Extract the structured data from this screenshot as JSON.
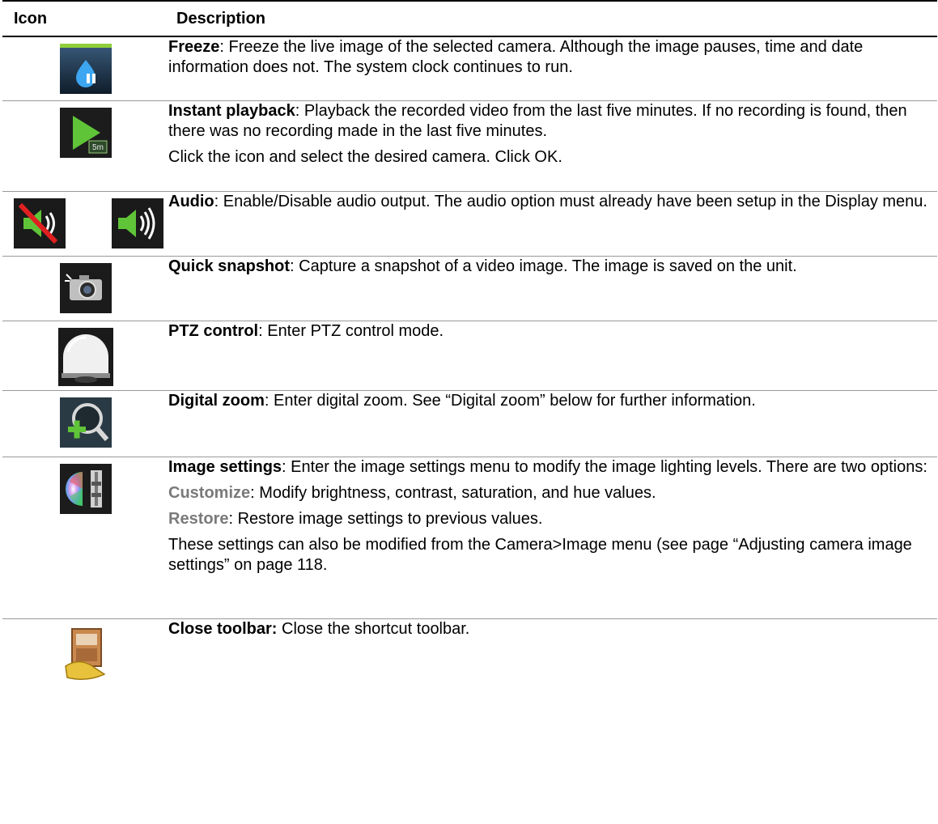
{
  "headers": {
    "icon": "Icon",
    "description": "Description"
  },
  "rows": [
    {
      "icons": [
        "freeze-icon"
      ],
      "term": "Freeze",
      "text": ": Freeze the live image of the selected camera. Although the image pauses, time and date information does not. The system clock continues to run."
    },
    {
      "icons": [
        "instant-playback-icon"
      ],
      "icon_badge": "5m",
      "term": "Instant playback",
      "text": ": Playback the recorded video from the last five minutes. If no recording is found, then there was no recording made in the last five minutes.",
      "extra": "Click the icon and select the desired camera. Click OK."
    },
    {
      "icons": [
        "audio-off-icon",
        "audio-on-icon"
      ],
      "term": "Audio",
      "text": ": Enable/Disable audio output. The audio option must already have been setup in the Display menu."
    },
    {
      "icons": [
        "camera-snapshot-icon"
      ],
      "term": "Quick snapshot",
      "text": ": Capture a snapshot of a video image. The image is saved on the unit."
    },
    {
      "icons": [
        "ptz-dome-icon"
      ],
      "term": "PTZ control",
      "text": ": Enter PTZ control mode."
    },
    {
      "icons": [
        "digital-zoom-icon"
      ],
      "term": "Digital zoom",
      "text": ": Enter digital zoom. See “Digital zoom” below for further information."
    },
    {
      "icons": [
        "image-settings-icon"
      ],
      "term": "Image settings",
      "text": ": Enter the image settings menu to modify the image lighting levels. There are two options:",
      "options": [
        {
          "term": "Customize",
          "text": ": Modify brightness, contrast, saturation, and hue values."
        },
        {
          "term": "Restore",
          "text": ": Restore image settings to previous values."
        }
      ],
      "extra": "These settings can also be modified from the Camera>Image menu (see page “Adjusting camera image settings” on page 118."
    },
    {
      "icons": [
        "close-toolbar-icon"
      ],
      "term": "Close toolbar:",
      "text": " Close the shortcut toolbar."
    }
  ]
}
